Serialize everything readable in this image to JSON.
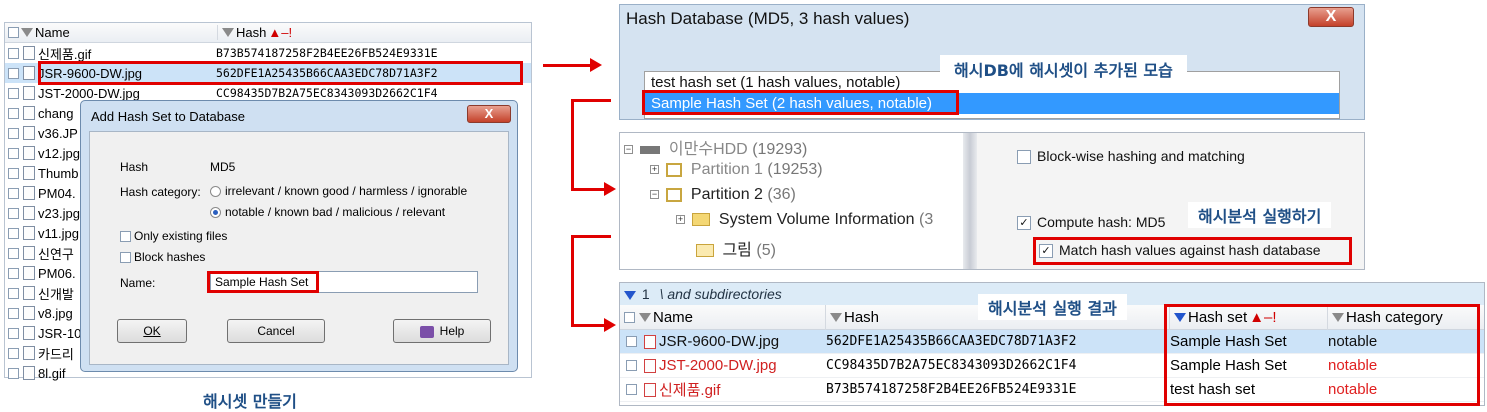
{
  "file_list": {
    "headers": {
      "name": "Name",
      "hash": "Hash",
      "hash_sort": "▲–!"
    },
    "rows": [
      {
        "name": "신제품.gif",
        "hash": "B73B574187258F2B4EE26FB524E9331E"
      },
      {
        "name": "JSR-9600-DW.jpg",
        "hash": "562DFE1A25435B66CAA3EDC78D71A3F2"
      },
      {
        "name": "JST-2000-DW.jpg",
        "hash": "CC98435D7B2A75EC8343093D2662C1F4"
      },
      {
        "name": "chang",
        "hash": ""
      },
      {
        "name": "v36.JP",
        "hash": ""
      },
      {
        "name": "v12.jpg",
        "hash": ""
      },
      {
        "name": "Thumb",
        "hash": ""
      },
      {
        "name": "PM04.",
        "hash": ""
      },
      {
        "name": "v23.jpg",
        "hash": ""
      },
      {
        "name": "v11.jpg",
        "hash": ""
      },
      {
        "name": "신연구",
        "hash": ""
      },
      {
        "name": "PM06.",
        "hash": ""
      },
      {
        "name": "신개발",
        "hash": ""
      },
      {
        "name": "v8.jpg",
        "hash": ""
      },
      {
        "name": "JSR-10",
        "hash": ""
      },
      {
        "name": "카드리",
        "hash": ""
      },
      {
        "name": "8l.gif",
        "hash": ""
      }
    ]
  },
  "add_dialog": {
    "title": "Add Hash Set to Database",
    "close": "X",
    "hash_label": "Hash",
    "hash_value": "MD5",
    "category_label": "Hash category:",
    "category_options": [
      "irrelevant / known good / harmless / ignorable",
      "notable / known bad / malicious / relevant"
    ],
    "only_existing": "Only existing files",
    "block_hashes": "Block hashes",
    "name_label": "Name:",
    "name_value": "Sample Hash Set",
    "ok": "OK",
    "cancel": "Cancel",
    "help": "Help"
  },
  "caption_create": "해시셋 만들기",
  "hash_db": {
    "title": "Hash Database (MD5, 3 hash values)",
    "close": "X",
    "items": [
      "test hash set (1 hash values, notable)",
      "Sample Hash Set (2 hash values, notable)"
    ],
    "caption": "해시DB에 해시셋이 추가된 모습"
  },
  "tree": {
    "nodes": [
      {
        "label": "이만수HDD",
        "count": "(19293)"
      },
      {
        "label": "Partition 1",
        "count": "(19253)"
      },
      {
        "label": "Partition 2",
        "count": "(36)"
      },
      {
        "label": "System Volume Information",
        "count": "(3"
      },
      {
        "label": "그림",
        "count": "(5)"
      }
    ]
  },
  "options": {
    "block_wise": "Block-wise hashing and matching",
    "compute_hash": "Compute hash: MD5",
    "match_hash": "Match hash values against hash database",
    "caption": "해시분석 실행하기"
  },
  "results": {
    "filter_count": "1",
    "filter_text": "\\ and subdirectories",
    "caption": "해시분석 실행 결과",
    "headers": {
      "name": "Name",
      "hash": "Hash",
      "hash_set": "Hash set",
      "hash_set_sort": "▲–!",
      "category": "Hash category"
    },
    "rows": [
      {
        "name": "JSR-9600-DW.jpg",
        "hash": "562DFE1A25435B66CAA3EDC78D71A3F2",
        "set": "Sample Hash Set",
        "category": "notable"
      },
      {
        "name": "JST-2000-DW.jpg",
        "hash": "CC98435D7B2A75EC8343093D2662C1F4",
        "set": "Sample Hash Set",
        "category": "notable"
      },
      {
        "name": "신제품.gif",
        "hash": "B73B574187258F2B4EE26FB524E9331E",
        "set": "test hash set",
        "category": "notable"
      }
    ]
  },
  "colors": {
    "highlight": "#e00000",
    "selection": "#cce3f8",
    "caption": "#1f4f86"
  }
}
